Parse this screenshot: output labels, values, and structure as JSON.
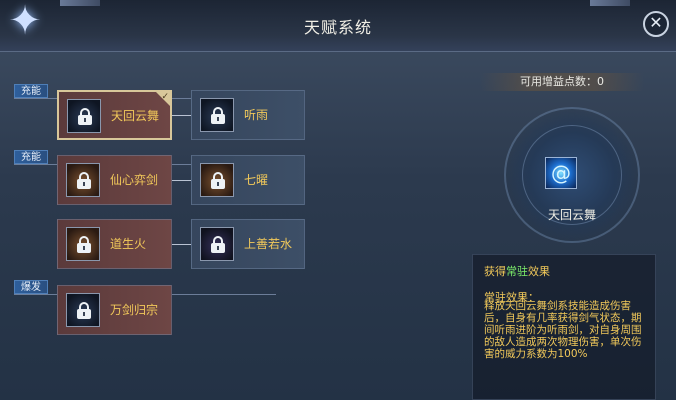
{
  "window": {
    "title": "天赋系统",
    "close_icon": "close-x-icon"
  },
  "tags": [
    "充能",
    "充能",
    "爆发"
  ],
  "rows": [
    {
      "left": {
        "label": "天回云舞",
        "selected": true,
        "locked": true
      },
      "right": {
        "label": "听雨",
        "locked": true
      }
    },
    {
      "left": {
        "label": "仙心弈剑",
        "locked": true
      },
      "right": {
        "label": "七曜",
        "locked": true
      }
    },
    {
      "left": {
        "label": "道生火",
        "locked": true
      },
      "right": {
        "label": "上善若水",
        "locked": true
      }
    },
    {
      "left": {
        "label": "万剑归宗",
        "locked": true
      }
    }
  ],
  "panel": {
    "points": "可用增益点数：0",
    "skill_name": "天回云舞",
    "desc_title_pre": "获得",
    "desc_title_em": "常驻",
    "desc_title_post": "效果",
    "desc_head": "常驻效果：",
    "desc_body": "释放天回云舞剑系技能造成伤害后，自身有几率获得剑气状态，期间听雨进阶为听雨剑，对自身周围的敌人造成两次物理伤害，单次伤害的威力系数为100%"
  },
  "colors": {
    "gold_text": "#f2c95a",
    "green_text": "#7dee6a",
    "tag_blue": "#2e5f9c"
  }
}
